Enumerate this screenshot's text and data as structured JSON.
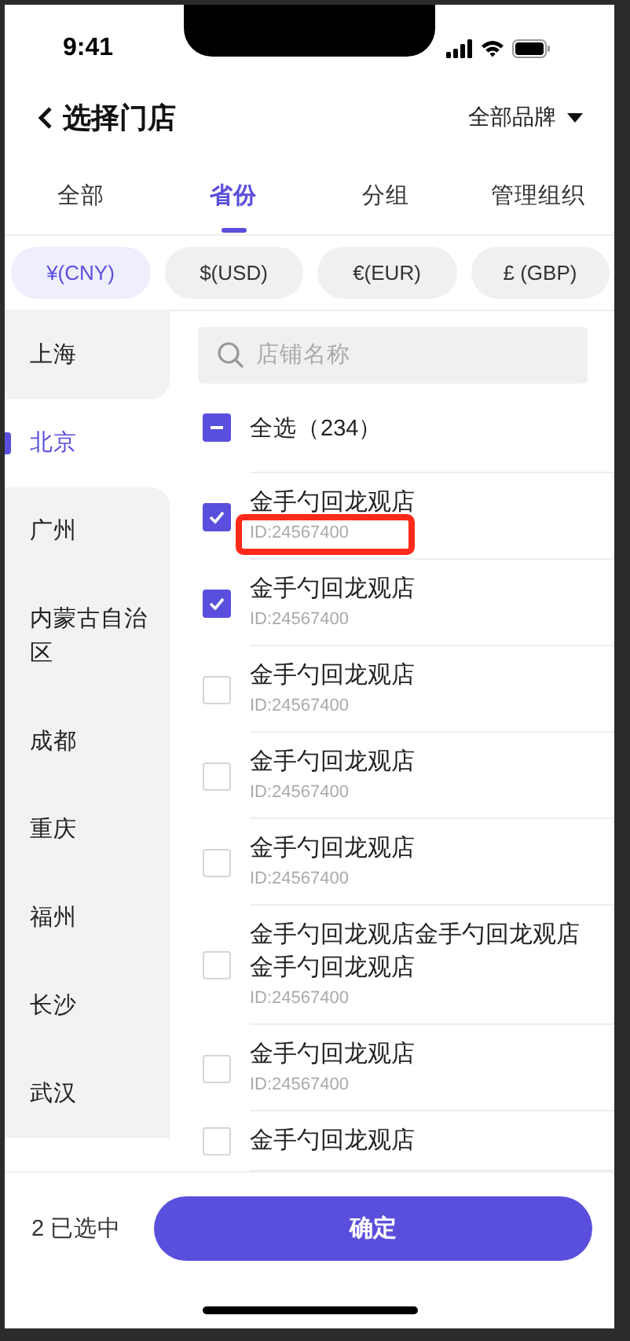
{
  "status_bar": {
    "time": "9:41"
  },
  "header": {
    "title": "选择门店",
    "brand_filter": "全部品牌"
  },
  "tabs": [
    {
      "label": "全部",
      "selected": false
    },
    {
      "label": "省份",
      "selected": true
    },
    {
      "label": "分组",
      "selected": false
    },
    {
      "label": "管理组织",
      "selected": false
    }
  ],
  "currencies": [
    {
      "label": "¥(CNY)",
      "selected": true
    },
    {
      "label": "$(USD)",
      "selected": false
    },
    {
      "label": "€(EUR)",
      "selected": false
    },
    {
      "label": "£ (GBP)",
      "selected": false
    }
  ],
  "regions": [
    {
      "name": "上海",
      "selected": false
    },
    {
      "name": "北京",
      "selected": true
    },
    {
      "name": "广州",
      "selected": false
    },
    {
      "name": "内蒙古自治区",
      "selected": false
    },
    {
      "name": "成都",
      "selected": false
    },
    {
      "name": "重庆",
      "selected": false
    },
    {
      "name": "福州",
      "selected": false
    },
    {
      "name": "长沙",
      "selected": false
    },
    {
      "name": "武汉",
      "selected": false
    }
  ],
  "search": {
    "placeholder": "店铺名称"
  },
  "select_all": {
    "label": "全选（234）",
    "indeterminate": true
  },
  "stores": [
    {
      "name": "金手勺回龙观店",
      "id": "ID:24567400",
      "checked": true,
      "highlighted": true
    },
    {
      "name": "金手勺回龙观店",
      "id": "ID:24567400",
      "checked": true,
      "highlighted": false
    },
    {
      "name": "金手勺回龙观店",
      "id": "ID:24567400",
      "checked": false,
      "highlighted": false
    },
    {
      "name": "金手勺回龙观店",
      "id": "ID:24567400",
      "checked": false,
      "highlighted": false
    },
    {
      "name": "金手勺回龙观店",
      "id": "ID:24567400",
      "checked": false,
      "highlighted": false
    },
    {
      "name": "金手勺回龙观店金手勺回龙观店金手勺回龙观店",
      "id": "ID:24567400",
      "checked": false,
      "highlighted": false
    },
    {
      "name": "金手勺回龙观店",
      "id": "ID:24567400",
      "checked": false,
      "highlighted": false
    },
    {
      "name": "金手勺回龙观店",
      "checked": false,
      "highlighted": false
    }
  ],
  "footer": {
    "selected_count": "2 已选中",
    "confirm": "确定"
  }
}
